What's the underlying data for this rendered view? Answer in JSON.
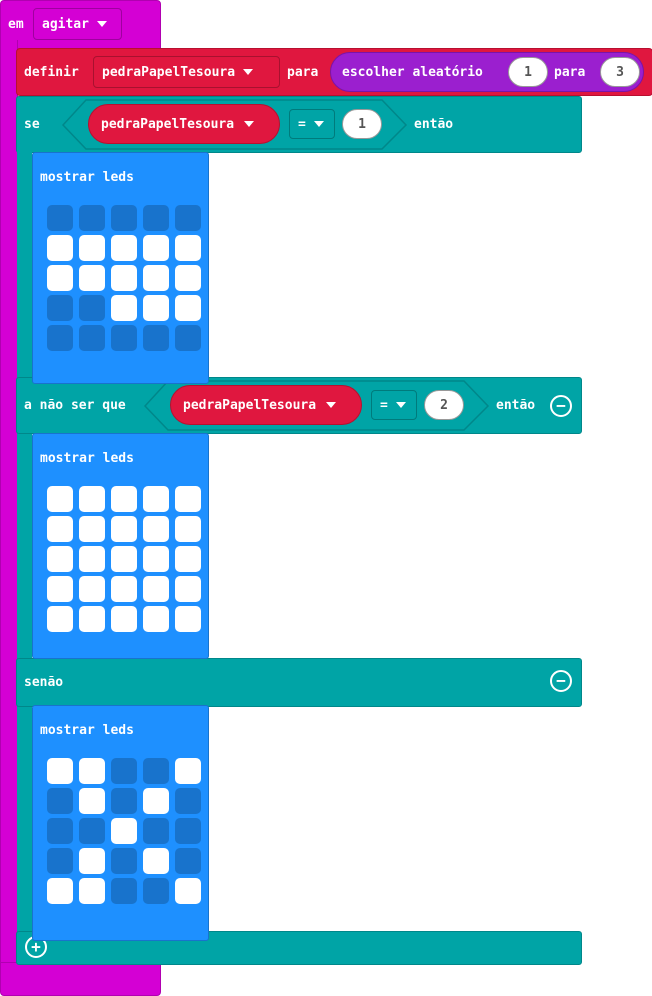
{
  "event": {
    "label": "em",
    "dropdown": "agitar"
  },
  "set": {
    "label": "definir",
    "variable": "pedraPapelTesoura",
    "to_label": "para",
    "random": {
      "label": "escolher aleatório",
      "from": "1",
      "to_label": "para",
      "to": "3"
    }
  },
  "if_block": {
    "if_label": "se",
    "then_label": "então",
    "elseif_label": "a não ser que",
    "else_label": "senão",
    "cond1": {
      "variable": "pedraPapelTesoura",
      "op": "=",
      "value": "1"
    },
    "cond2": {
      "variable": "pedraPapelTesoura",
      "op": "=",
      "value": "2"
    }
  },
  "leds": [
    {
      "label": "mostrar leds",
      "grid": [
        [
          0,
          0,
          0,
          0,
          0
        ],
        [
          1,
          1,
          1,
          1,
          1
        ],
        [
          1,
          1,
          1,
          1,
          1
        ],
        [
          0,
          0,
          1,
          1,
          1
        ],
        [
          0,
          0,
          0,
          0,
          0
        ]
      ]
    },
    {
      "label": "mostrar leds",
      "grid": [
        [
          1,
          1,
          1,
          1,
          1
        ],
        [
          1,
          1,
          1,
          1,
          1
        ],
        [
          1,
          1,
          1,
          1,
          1
        ],
        [
          1,
          1,
          1,
          1,
          1
        ],
        [
          1,
          1,
          1,
          1,
          1
        ]
      ]
    },
    {
      "label": "mostrar leds",
      "grid": [
        [
          1,
          1,
          0,
          0,
          1
        ],
        [
          0,
          1,
          0,
          1,
          0
        ],
        [
          0,
          0,
          1,
          0,
          0
        ],
        [
          0,
          1,
          0,
          1,
          0
        ],
        [
          1,
          1,
          0,
          0,
          1
        ]
      ]
    }
  ],
  "colors": {
    "event": "#d400d4",
    "variables": "#e0173f",
    "math": "#9b1fcf",
    "logic": "#00a4a6",
    "basic": "#1e90ff"
  }
}
